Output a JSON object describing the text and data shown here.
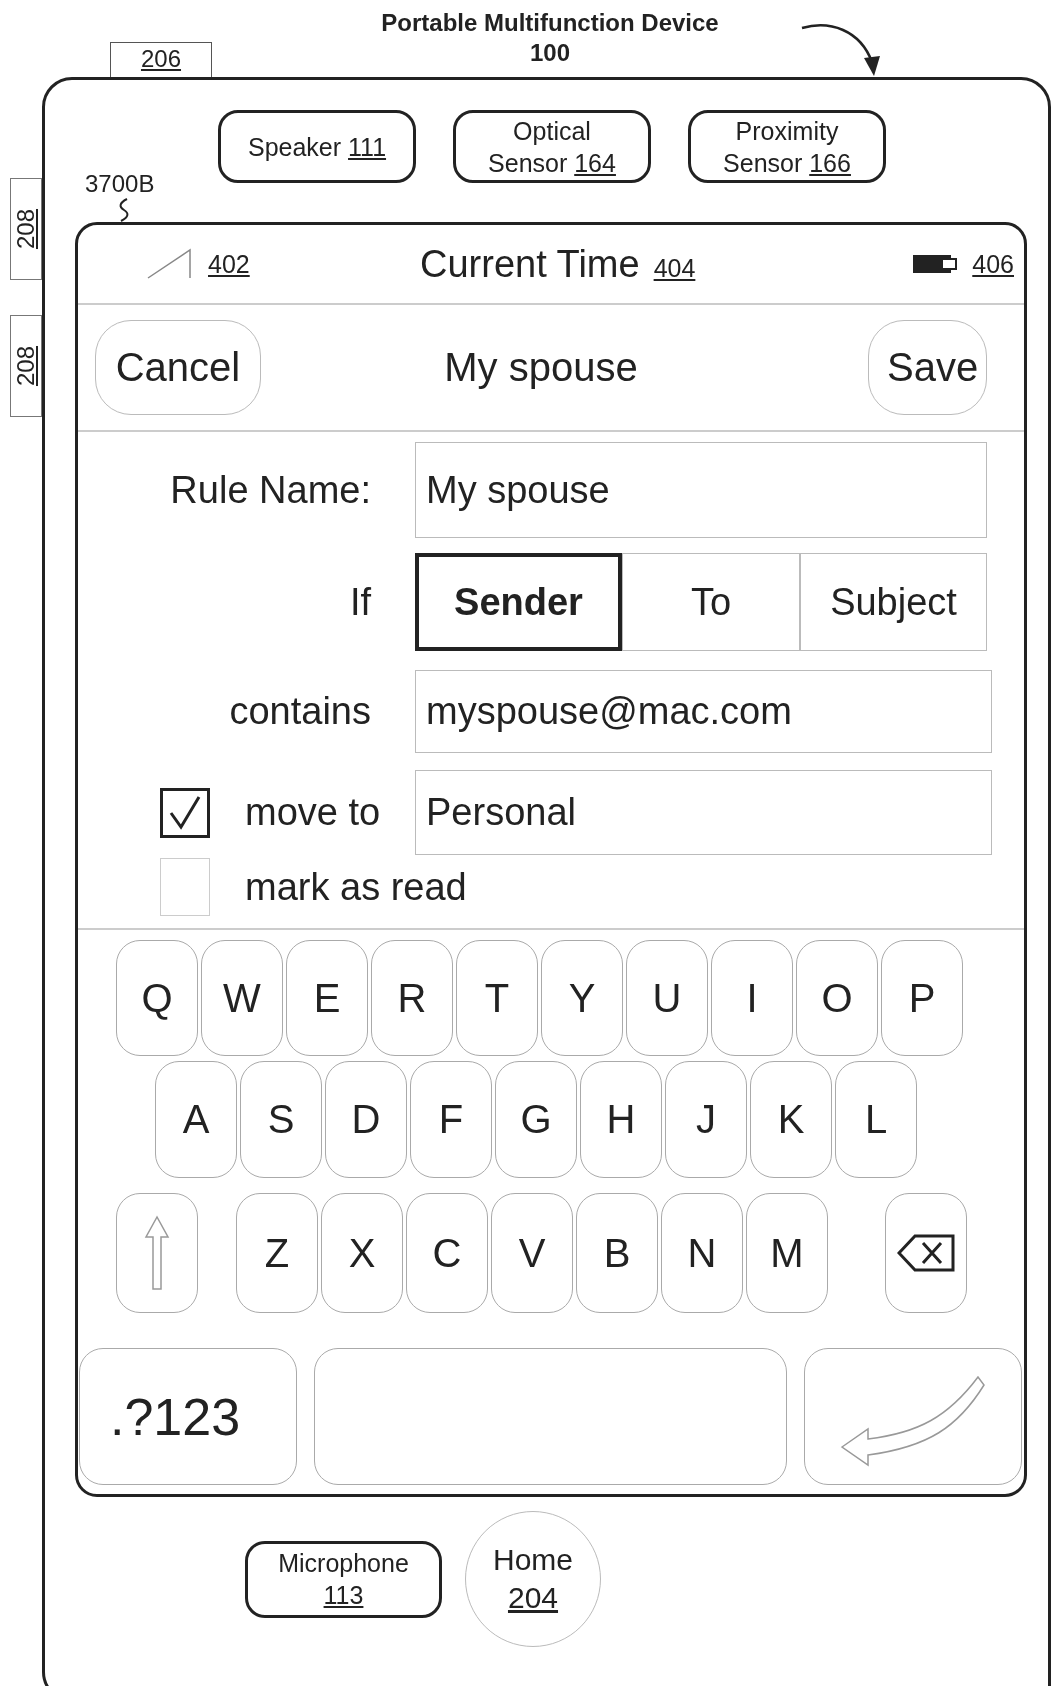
{
  "header": {
    "title": "Portable Multifunction Device",
    "number": "100",
    "tab_ref": "206"
  },
  "side_refs": [
    "208",
    "208"
  ],
  "sensors": [
    {
      "name": "Speaker",
      "number": "111"
    },
    {
      "name": "Optical Sensor",
      "number": "164"
    },
    {
      "name": "Proximity Sensor",
      "number": "166"
    }
  ],
  "screen_ref": "3700B",
  "status_bar": {
    "signal_ref": "402",
    "time": "Current Time",
    "time_ref": "404",
    "battery_ref": "406"
  },
  "nav_bar": {
    "left_button": "Cancel",
    "title": "My spouse",
    "right_button": "Save"
  },
  "form": {
    "rule_name_label": "Rule Name:",
    "rule_name_value": "My spouse",
    "if_label": "If",
    "segments": [
      {
        "label": "Sender",
        "selected": true
      },
      {
        "label": "To",
        "selected": false
      },
      {
        "label": "Subject",
        "selected": false
      }
    ],
    "contains_label": "contains",
    "contains_value": "myspouse@mac.com",
    "options": [
      {
        "label": "move to",
        "checked": true,
        "value": "Personal"
      },
      {
        "label": "mark as read",
        "checked": false
      }
    ]
  },
  "keyboard": {
    "rows": [
      [
        "Q",
        "W",
        "E",
        "R",
        "T",
        "Y",
        "U",
        "I",
        "O",
        "P"
      ],
      [
        "A",
        "S",
        "D",
        "F",
        "G",
        "H",
        "J",
        "K",
        "L"
      ],
      [
        "Z",
        "X",
        "C",
        "V",
        "B",
        "N",
        "M"
      ]
    ],
    "numbers_key": ".?123"
  },
  "bottom": {
    "microphone": {
      "name": "Microphone",
      "number": "113"
    },
    "home": {
      "name": "Home",
      "number": "204"
    }
  }
}
